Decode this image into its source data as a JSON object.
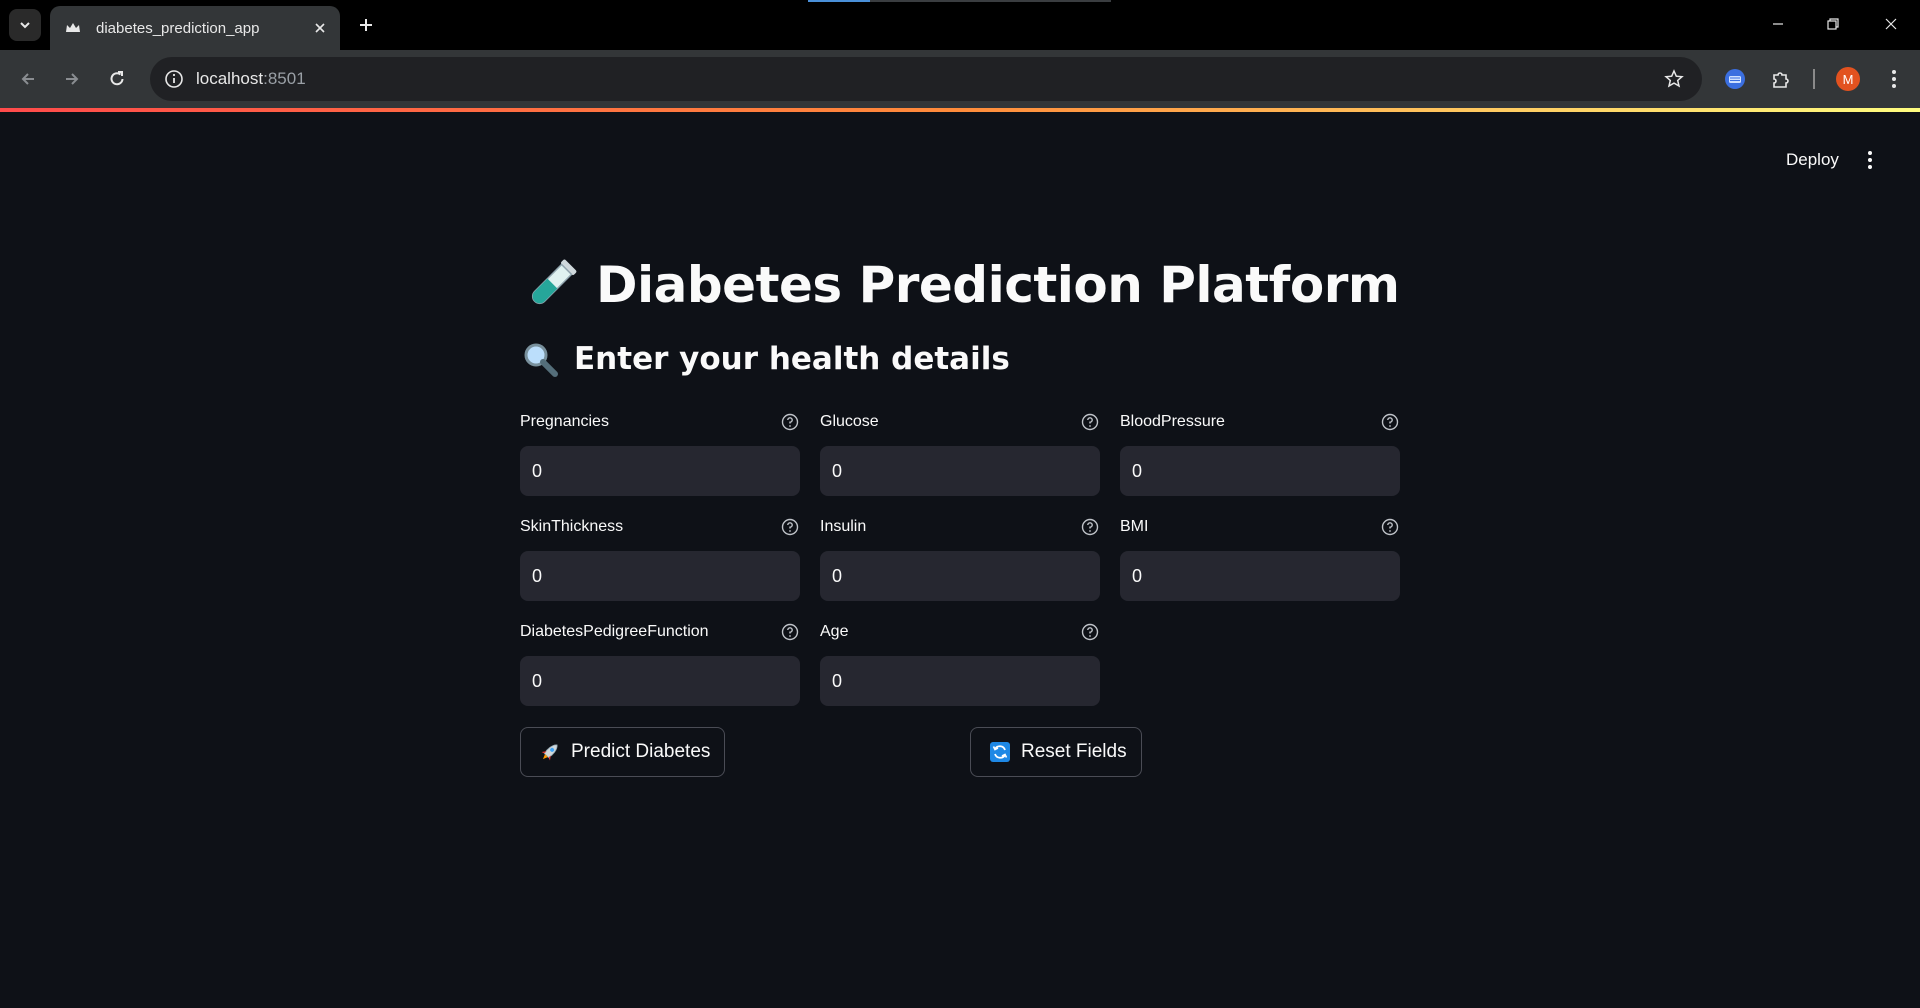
{
  "browser": {
    "tab_title": "diabetes_prediction_app",
    "url_host": "localhost",
    "url_port": ":8501",
    "avatar_initial": "M"
  },
  "header": {
    "deploy_label": "Deploy"
  },
  "main": {
    "title": "Diabetes Prediction Platform",
    "title_emoji": "test-tube-icon",
    "subtitle": "Enter your health details",
    "subtitle_emoji": "magnifier-icon",
    "fields": [
      {
        "label": "Pregnancies",
        "value": "0"
      },
      {
        "label": "Glucose",
        "value": "0"
      },
      {
        "label": "BloodPressure",
        "value": "0"
      },
      {
        "label": "SkinThickness",
        "value": "0"
      },
      {
        "label": "Insulin",
        "value": "0"
      },
      {
        "label": "BMI",
        "value": "0"
      },
      {
        "label": "DiabetesPedigreeFunction",
        "value": "0"
      },
      {
        "label": "Age",
        "value": "0"
      }
    ],
    "predict_button": "Predict Diabetes",
    "reset_button": "Reset Fields"
  },
  "colors": {
    "background": "#0e1117",
    "input_bg": "#262730",
    "accent_gradient_start": "#ff4b4b",
    "accent_gradient_end": "#fffd80"
  }
}
